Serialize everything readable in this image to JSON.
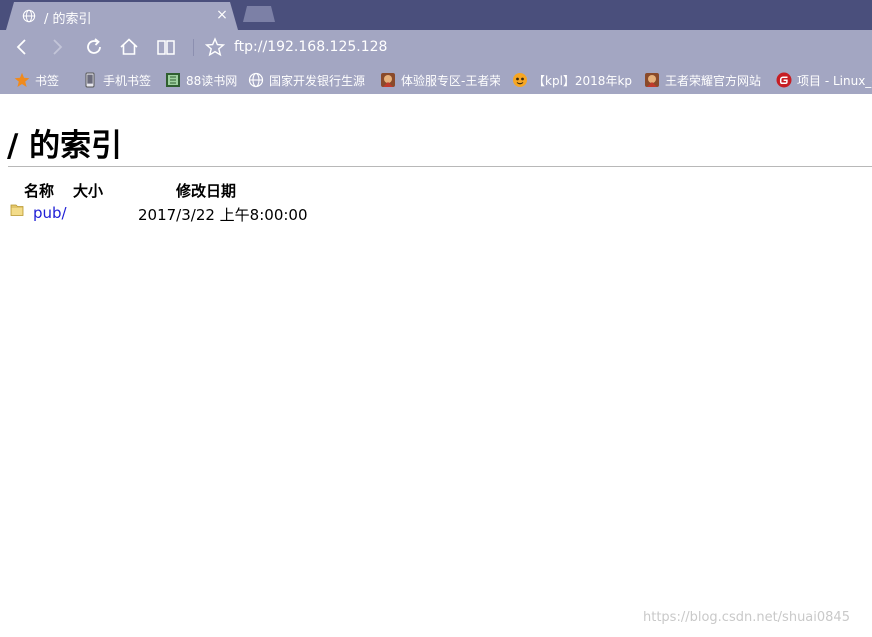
{
  "browser": {
    "tab": {
      "title": "/ 的索引",
      "icon": "globe-icon",
      "close_glyph": "×"
    },
    "new_tab_icon": "new-tab-icon",
    "nav": {
      "back_icon": "back-icon",
      "forward_icon": "forward-icon",
      "reload_icon": "reload-icon",
      "home_icon": "home-icon",
      "reader_icon": "reader-icon"
    },
    "address": {
      "star_icon": "star-icon",
      "url": "ftp://192.168.125.128"
    },
    "bookmarks": [
      {
        "label": "书签",
        "icon": "star-icon"
      },
      {
        "label": "手机书签",
        "icon": "phone-icon"
      },
      {
        "label": "88读书网",
        "icon": "book-site-icon"
      },
      {
        "label": "国家开发银行生源",
        "icon": "globe-icon"
      },
      {
        "label": "体验服专区-王者荣",
        "icon": "game-hero-icon"
      },
      {
        "label": "【kpl】2018年kp",
        "icon": "video-site-icon"
      },
      {
        "label": "王者荣耀官方网站",
        "icon": "game-hero-icon"
      },
      {
        "label": "项目 - Linux_c",
        "icon": "gitee-icon"
      }
    ],
    "colors": {
      "tabstrip": "#4a4f7c",
      "toolbar": "#a3a6c2",
      "link": "#1f1fd6"
    }
  },
  "page": {
    "title": "/ 的索引",
    "columns": {
      "name": "名称",
      "size": "大小",
      "modified": "修改日期"
    },
    "entries": [
      {
        "name": "pub/",
        "size": "",
        "modified": "2017/3/22 上午8:00:00",
        "icon": "folder-icon"
      }
    ],
    "watermark": "https://blog.csdn.net/shuai0845"
  }
}
